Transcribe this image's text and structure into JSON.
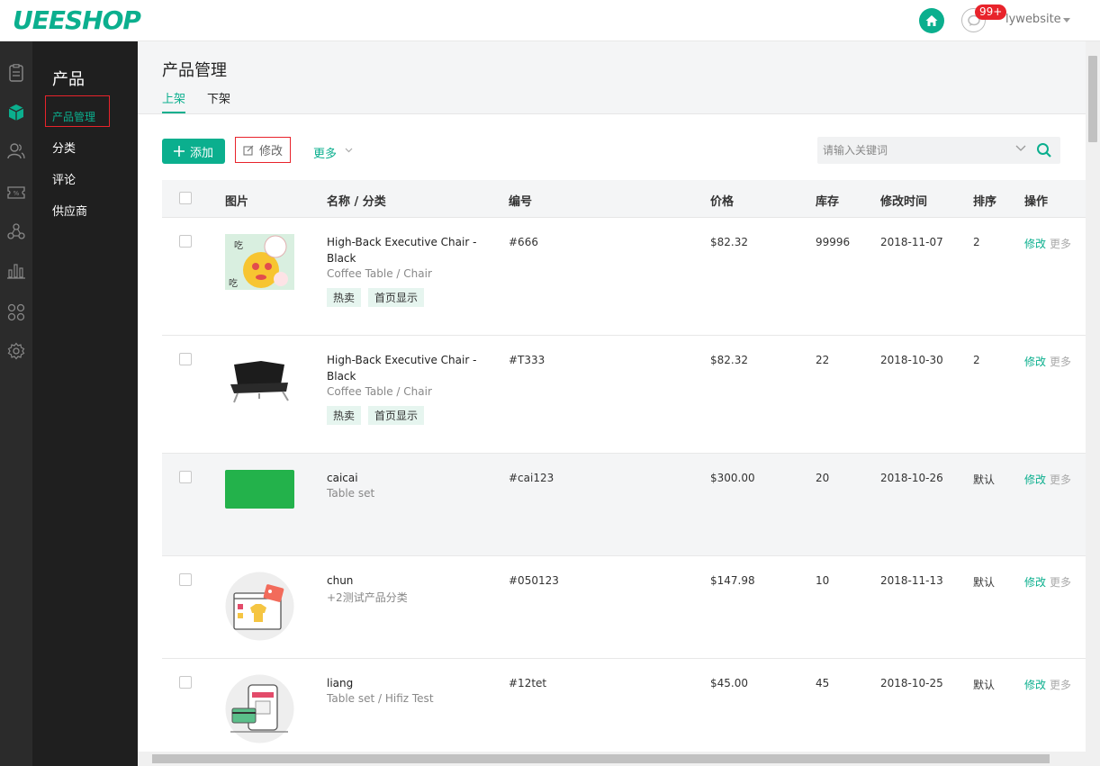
{
  "header": {
    "logo": "UEESHOP",
    "badge": "99+",
    "username": "lywebsite"
  },
  "rail": {
    "icons": [
      "orders-icon",
      "products-icon",
      "users-icon",
      "coupon-icon",
      "share-icon",
      "stats-icon",
      "apps-icon",
      "settings-icon"
    ],
    "active_index": 1
  },
  "submenu": {
    "title": "产品",
    "items": [
      {
        "label": "产品管理"
      },
      {
        "label": "分类"
      },
      {
        "label": "评论"
      },
      {
        "label": "供应商"
      }
    ]
  },
  "page": {
    "title": "产品管理",
    "tabs": [
      {
        "label": "上架"
      },
      {
        "label": "下架"
      }
    ]
  },
  "toolbar": {
    "add_label": "添加",
    "edit_label": "修改",
    "more_label": "更多",
    "search_placeholder": "请输入关键词"
  },
  "table": {
    "headers": {
      "image": "图片",
      "name": "名称 / 分类",
      "number": "编号",
      "price": "价格",
      "stock": "库存",
      "modified": "修改时间",
      "sort": "排序",
      "action": "操作"
    },
    "rows": [
      {
        "name": "High-Back Executive Chair - Black",
        "category": "Coffee Table / Chair",
        "tags": [
          "热卖",
          "首页显示"
        ],
        "number": "#666",
        "price": "$82.32",
        "stock": "99996",
        "date": "2018-11-07",
        "sort": "2",
        "edit": "修改",
        "more": "更多",
        "image": "cartoon-cat"
      },
      {
        "name": "High-Back Executive Chair - Black",
        "category": "Coffee Table / Chair",
        "tags": [
          "热卖",
          "首页显示"
        ],
        "number": "#T333",
        "price": "$82.32",
        "stock": "22",
        "date": "2018-10-30",
        "sort": "2",
        "edit": "修改",
        "more": "更多",
        "image": "black-chair"
      },
      {
        "name": "caicai",
        "category": "Table set",
        "tags": [],
        "number": "#cai123",
        "price": "$300.00",
        "stock": "20",
        "date": "2018-10-26",
        "sort": "默认",
        "edit": "修改",
        "more": "更多",
        "image": "green-block"
      },
      {
        "name": "chun",
        "category": "+2测试产品分类",
        "tags": [],
        "number": "#050123",
        "price": "$147.98",
        "stock": "10",
        "date": "2018-11-13",
        "sort": "默认",
        "edit": "修改",
        "more": "更多",
        "image": "shop-illustration"
      },
      {
        "name": "liang",
        "category": "Table set / Hifiz Test",
        "tags": [],
        "number": "#12tet",
        "price": "$45.00",
        "stock": "45",
        "date": "2018-10-25",
        "sort": "默认",
        "edit": "修改",
        "more": "更多",
        "image": "tablet-illustration"
      }
    ]
  },
  "colors": {
    "accent": "#0baf8e",
    "rail": "#2b2b2b",
    "submenu": "#1f1f1f",
    "badge": "#e8232b"
  }
}
